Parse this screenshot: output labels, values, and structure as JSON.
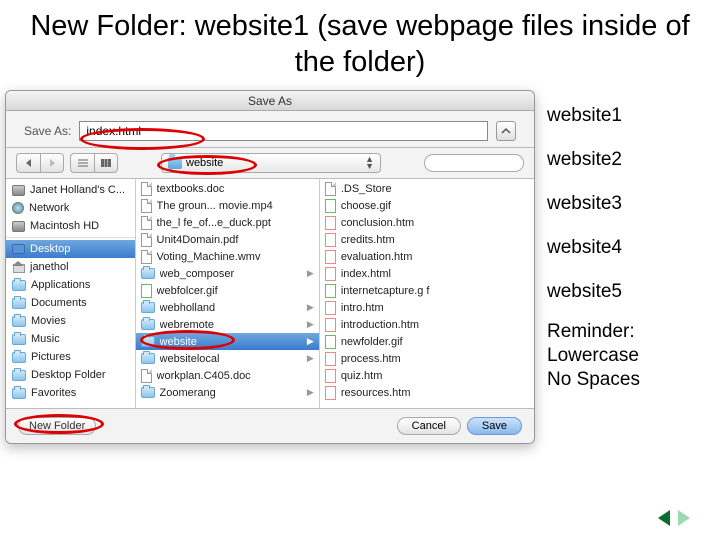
{
  "title": "New Folder: website1 (save webpage files inside of the folder)",
  "dialog": {
    "title": "Save As",
    "saveAsLabel": "Save As:",
    "saveAsValue": "index.html",
    "locationFolder": "website",
    "sidebar": {
      "devices": [
        {
          "label": "Janet Holland's C...",
          "icon": "hd"
        },
        {
          "label": "Network",
          "icon": "net"
        },
        {
          "label": "Macintosh HD",
          "icon": "hd"
        }
      ],
      "places": [
        {
          "label": "Desktop",
          "icon": "desk",
          "selected": true
        },
        {
          "label": "janethol",
          "icon": "home"
        },
        {
          "label": "Applications",
          "icon": "fold"
        },
        {
          "label": "Documents",
          "icon": "fold"
        },
        {
          "label": "Movies",
          "icon": "fold"
        },
        {
          "label": "Music",
          "icon": "fold"
        },
        {
          "label": "Pictures",
          "icon": "fold"
        },
        {
          "label": "Desktop Folder",
          "icon": "fold"
        },
        {
          "label": "Favorites",
          "icon": "fold"
        }
      ]
    },
    "col2": [
      {
        "label": "textbooks.doc",
        "icon": "doc"
      },
      {
        "label": "The groun... movie.mp4",
        "icon": "doc"
      },
      {
        "label": "the_l fe_of...e_duck.ppt",
        "icon": "doc"
      },
      {
        "label": "Unit4Domain.pdf",
        "icon": "doc"
      },
      {
        "label": "Voting_Machine.wmv",
        "icon": "doc"
      },
      {
        "label": "web_composer",
        "icon": "fold",
        "folder": true
      },
      {
        "label": "webfolcer.gif",
        "icon": "gif"
      },
      {
        "label": "webholland",
        "icon": "fold",
        "folder": true
      },
      {
        "label": "webremote",
        "icon": "fold",
        "folder": true
      },
      {
        "label": "website",
        "icon": "fold",
        "folder": true,
        "selected": true
      },
      {
        "label": "websitelocal",
        "icon": "fold",
        "folder": true
      },
      {
        "label": "workplan.C405.doc",
        "icon": "doc"
      },
      {
        "label": "Zoomerang",
        "icon": "fold",
        "folder": true
      }
    ],
    "col3": [
      {
        "label": ".DS_Store",
        "icon": "doc"
      },
      {
        "label": "choose.gif",
        "icon": "gif"
      },
      {
        "label": "conclusion.htm",
        "icon": "htm"
      },
      {
        "label": "credits.htm",
        "icon": "htm"
      },
      {
        "label": "evaluation.htm",
        "icon": "htm"
      },
      {
        "label": "index.html",
        "icon": "htm"
      },
      {
        "label": "internetcapture.g f",
        "icon": "gif"
      },
      {
        "label": "intro.htm",
        "icon": "htm"
      },
      {
        "label": "introduction.htm",
        "icon": "htm"
      },
      {
        "label": "newfolder.gif",
        "icon": "gif"
      },
      {
        "label": "process.htm",
        "icon": "htm"
      },
      {
        "label": "quiz.htm",
        "icon": "htm"
      },
      {
        "label": "resources.htm",
        "icon": "htm"
      }
    ],
    "newFolderBtn": "New Folder",
    "cancelBtn": "Cancel",
    "saveBtn": "Save"
  },
  "rightList": [
    "website1",
    "website2",
    "website3",
    "website4",
    "website5"
  ],
  "reminder": [
    "Reminder:",
    "Lowercase",
    "No Spaces"
  ]
}
